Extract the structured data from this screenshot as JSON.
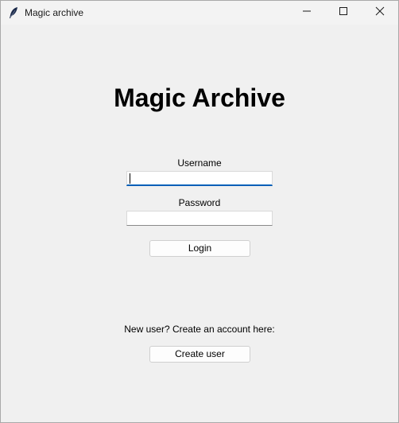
{
  "window": {
    "title": "Magic archive",
    "app_icon": "feather-icon",
    "controls": [
      "minimize-icon",
      "maximize-icon",
      "close-icon"
    ]
  },
  "main": {
    "heading": "Magic Archive",
    "username_label": "Username",
    "username_value": "",
    "password_label": "Password",
    "password_value": "",
    "login_label": "Login",
    "new_user_text": "New user? Create an account here:",
    "create_user_label": "Create user"
  },
  "colors": {
    "background": "#f0f0f0",
    "focus_accent": "#005fb8"
  }
}
